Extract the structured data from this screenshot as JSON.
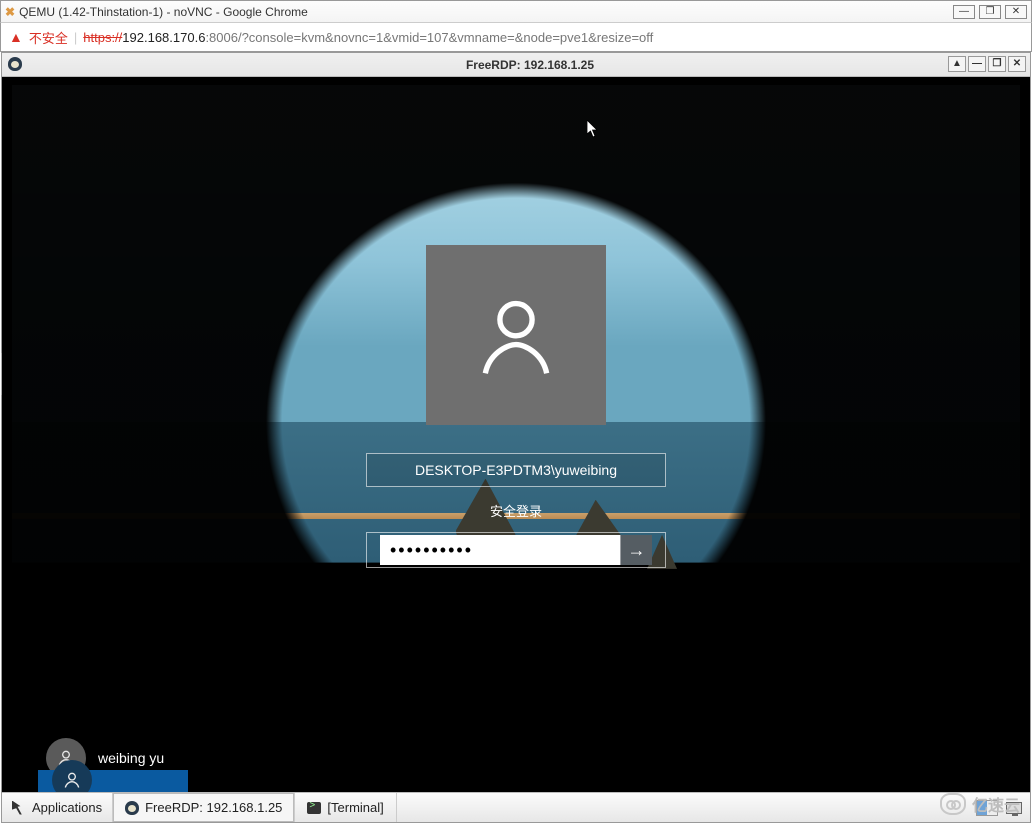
{
  "chrome": {
    "title": "QEMU (1.42-Thinstation-1) - noVNC - Google Chrome",
    "unsafe_label": "不安全",
    "https_label": "https://",
    "host": "192.168.170.6",
    "path": ":8006/?console=kvm&novnc=1&vmid=107&vmname=&node=pve1&resize=off",
    "min": "—",
    "max": "❐",
    "close": "✕"
  },
  "xfce": {
    "title": "FreeRDP: 192.168.1.25",
    "up": "▲",
    "min": "—",
    "max": "❐",
    "close": "✕"
  },
  "login": {
    "username": "DESKTOP-E3PDTM3\\yuweibing",
    "secure_label": "安全登录",
    "password_value": "••••••••••",
    "submit_glyph": "→"
  },
  "other_user": {
    "name": "weibing yu"
  },
  "taskbar": {
    "apps_label": "Applications",
    "task1": "FreeRDP: 192.168.1.25",
    "task2": "[Terminal]"
  },
  "side_tab": {
    "glyph": "▶"
  },
  "watermark": {
    "text": "亿速云"
  }
}
